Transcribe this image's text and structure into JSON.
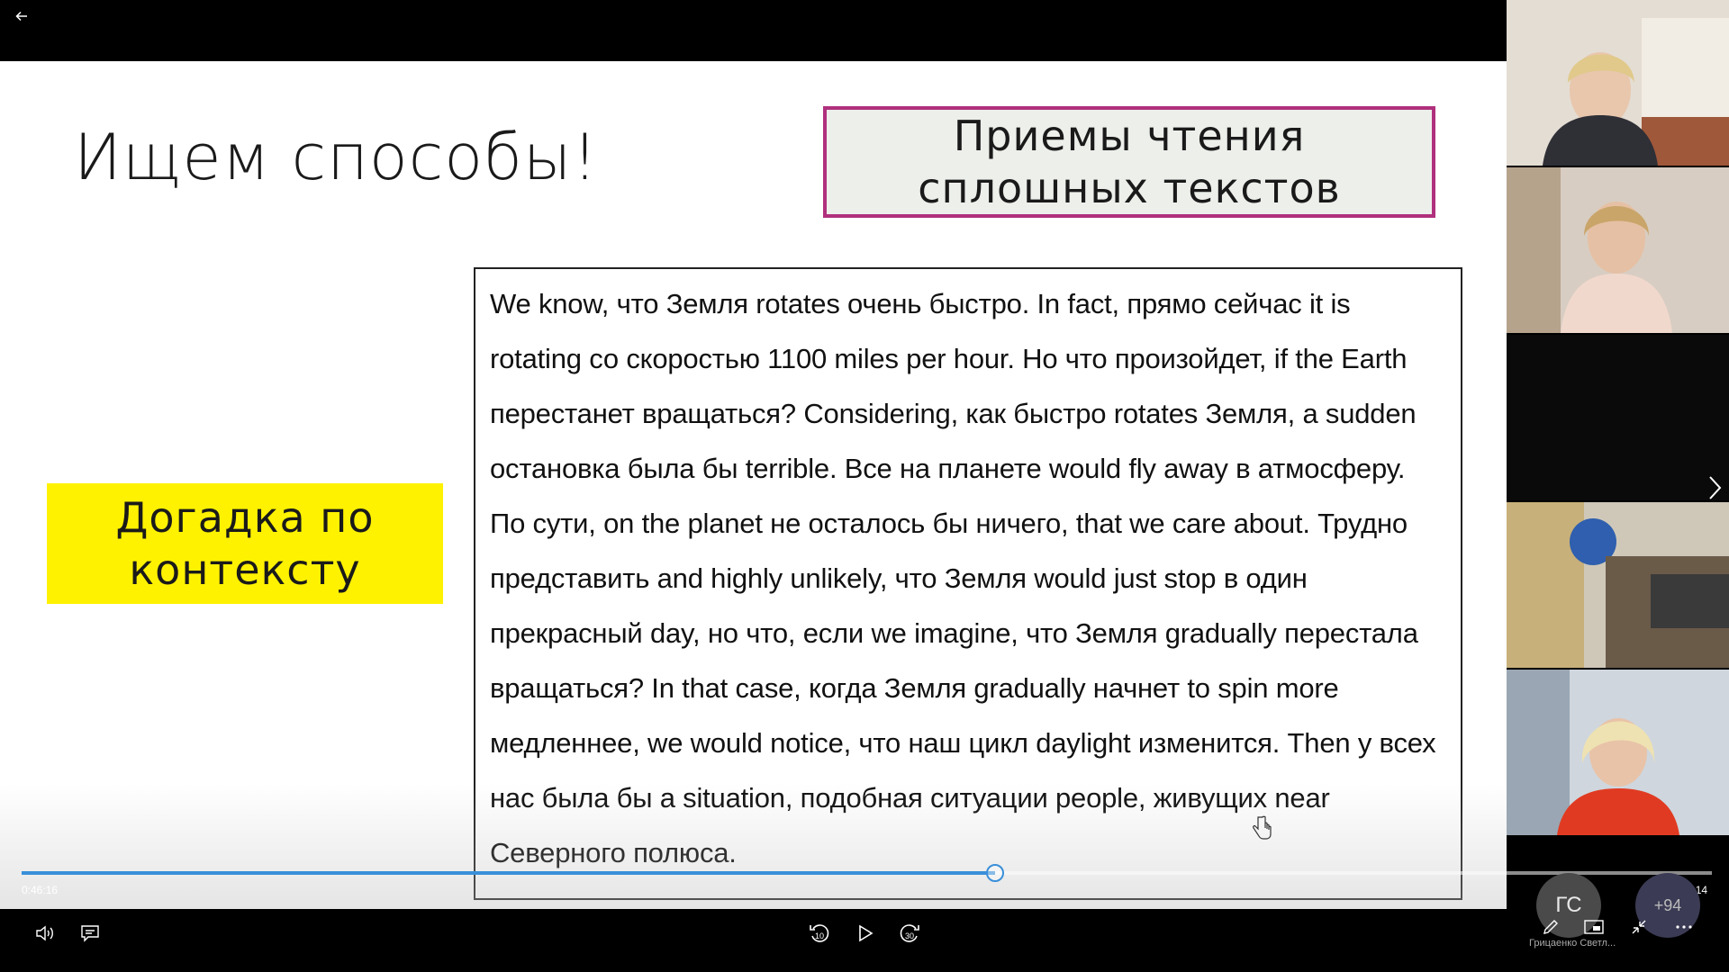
{
  "slide": {
    "title": "Ищем способы!",
    "method_box": "Приемы чтения сплошных текстов",
    "hint_box": "Догадка по контексту",
    "body_lines": [
      "We know, что Земля rotates очень быстро. In fact, прямо сейчас it is",
      "rotating со скоростью 1100 miles per hour. Но что произойдет, if the Earth",
      "перестанет вращаться? Considering, как быстро rotates Земля, a sudden",
      "остановка была бы terrible. Все на планете would fly away в атмосферу.",
      "По сути, on the planet не осталось бы ничего, that we care about. Трудно",
      "представить and highly unlikely, что Земля would just stop в один",
      "прекрасный day, но что, если we imagine, что Земля gradually перестала",
      "вращаться? In that case, когда Земля gradually начнет to spin more",
      "медленнее, we would notice, что наш цикл daylight изменится. Then у всех",
      "нас была бы a situation, подобная ситуации people, живущих near",
      "Северного полюса."
    ],
    "colors": {
      "method_border": "#b0307d",
      "hint_bg": "#fff200"
    }
  },
  "player": {
    "elapsed": "0:46:16",
    "remaining": "0:19:14",
    "progress_fraction": 0.576,
    "accent": "#3a8fd9"
  },
  "controls": {
    "volume_icon": "volume-icon",
    "captions_icon": "captions-icon",
    "rewind_icon": "rewind-10-icon",
    "rewind_label": "10",
    "play_icon": "play-icon",
    "forward_icon": "forward-30-icon",
    "forward_label": "30",
    "pen_icon": "pen-icon",
    "pip_icon": "picture-in-picture-icon",
    "minimize_icon": "minimize-icon",
    "more_icon": "more-icon"
  },
  "participants": {
    "avatar_initials": "ГС",
    "avatar_name": "Грицаенко Светл...",
    "extra_count": "+94"
  }
}
